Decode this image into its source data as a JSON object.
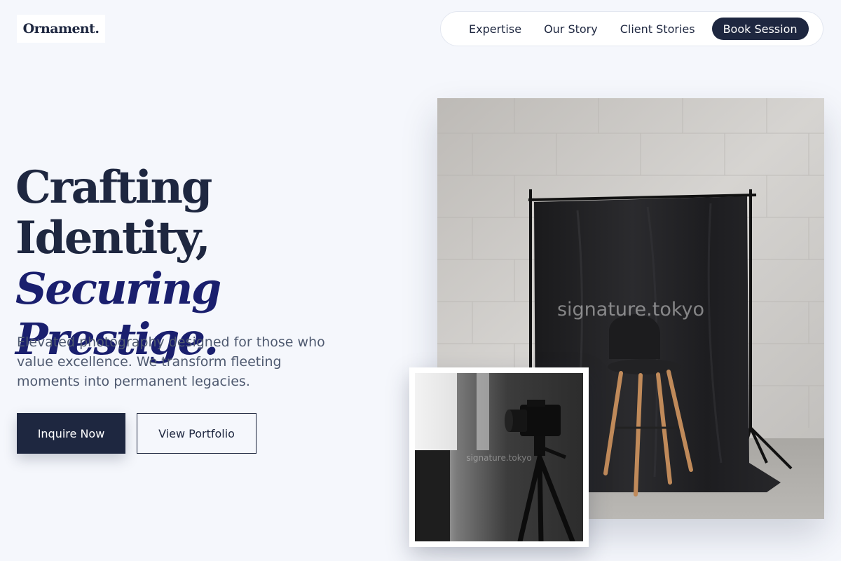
{
  "brand": {
    "logo_text": "Ornament."
  },
  "nav": {
    "items": [
      {
        "label": "Expertise"
      },
      {
        "label": "Our Story"
      },
      {
        "label": "Client Stories"
      }
    ],
    "cta_label": "Book Session"
  },
  "hero": {
    "headline_line1": "Crafting",
    "headline_line2": "Identity,",
    "headline_accent": "Securing Prestige.",
    "subcopy": "Elevated photography designed for those who value excellence. We transform fleeting moments into permanent legacies.",
    "primary_button": "Inquire Now",
    "secondary_button": "View Portfolio"
  },
  "images": {
    "main_watermark": "signature.tokyo",
    "inset_watermark": "signature.tokyo"
  },
  "colors": {
    "background": "#f5f7fc",
    "navy": "#1e2740",
    "accent_indigo": "#1a1f6e",
    "body_text": "#4f5a70"
  }
}
